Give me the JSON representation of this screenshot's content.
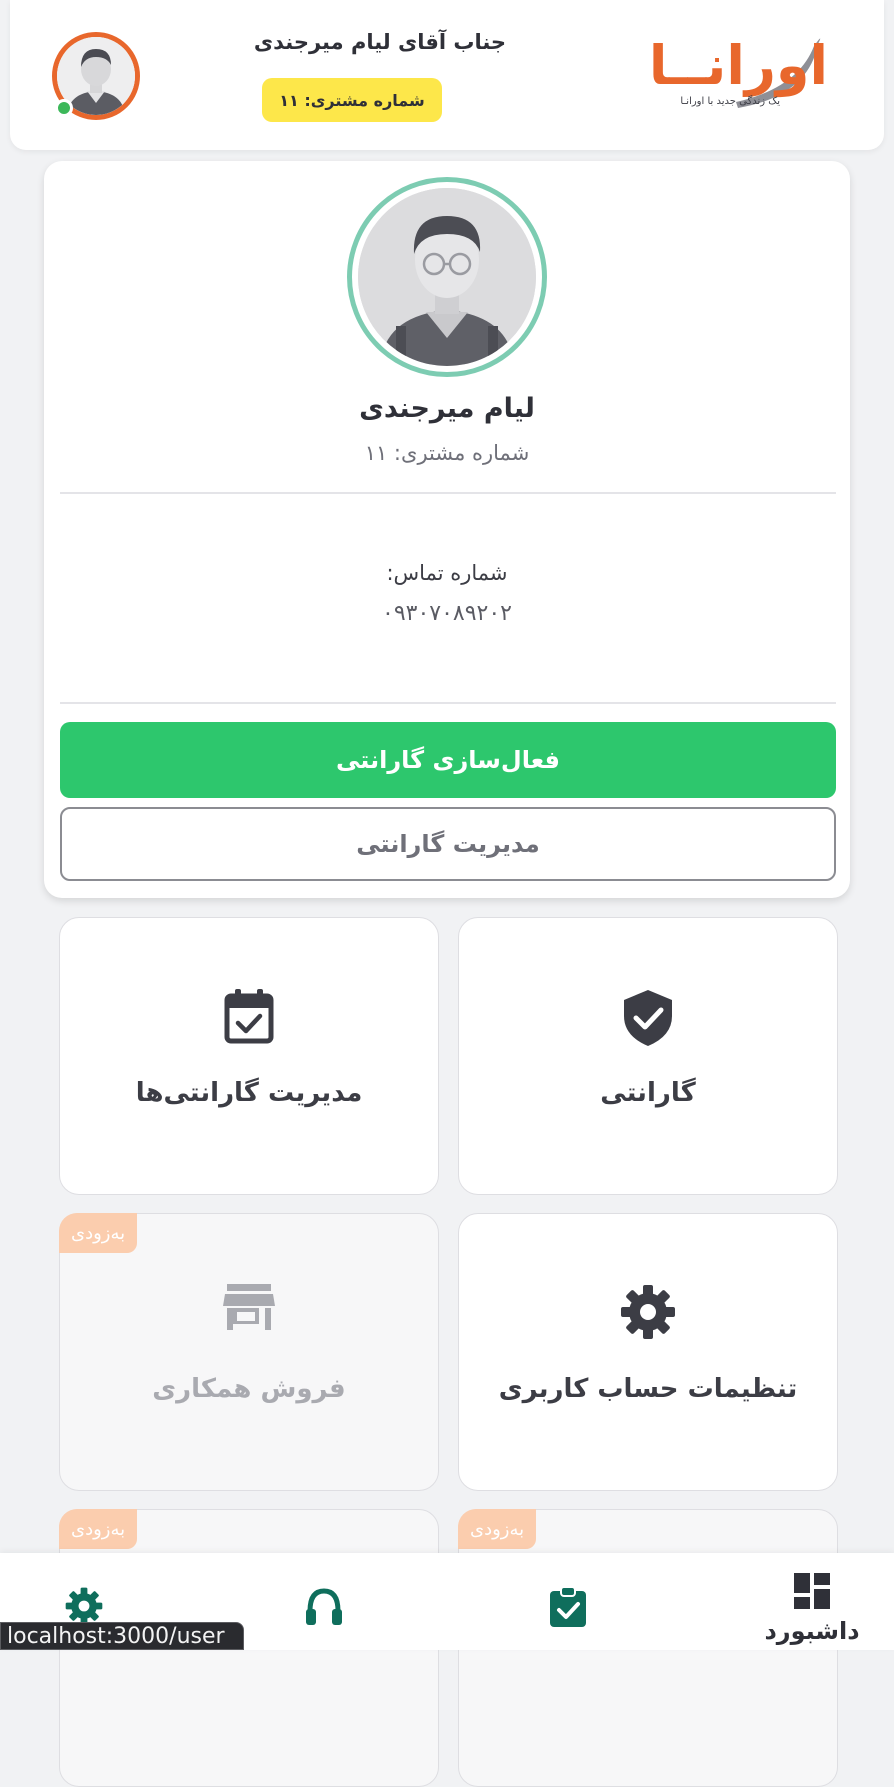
{
  "header": {
    "logo_text": "اورانــا",
    "logo_tagline": "یک زندگی جدید با اورانـا",
    "greeting": "جناب آقای لیام میرجندی",
    "customer_badge": "شماره مشتری: ۱۱",
    "online_status_color": "#3cb85a"
  },
  "profile": {
    "name": "لیام میرجندی",
    "customer_number": "شماره مشتری: ۱۱",
    "contact_label": "شماره تماس:",
    "contact_value": "۰۹۳۰۷۰۸۹۲۰۲",
    "activate_warranty_label": "فعال‌سازی گارانتی",
    "manage_warranty_label": "مدیریت گارانتی"
  },
  "tiles": [
    {
      "label": "گارانتی",
      "icon": "shield-check-icon",
      "coming_soon": false
    },
    {
      "label": "مدیریت گارانتی‌ها",
      "icon": "calendar-check-icon",
      "coming_soon": false
    },
    {
      "label": "تنظیمات حساب کاربری",
      "icon": "gear-icon",
      "coming_soon": false
    },
    {
      "label": "فروش همکاری",
      "icon": "store-icon",
      "coming_soon": true
    }
  ],
  "soon_label": "به‌زودی",
  "bottom_nav": [
    {
      "label": "داشبورد",
      "icon": "dashboard-icon",
      "active": true
    },
    {
      "label": "",
      "icon": "clipboard-check-icon",
      "active": false
    },
    {
      "label": "",
      "icon": "headset-icon",
      "active": false
    },
    {
      "label": "",
      "icon": "gear-icon",
      "active": false
    }
  ],
  "status_url": "localhost:3000/user",
  "colors": {
    "brand_orange": "#e8672c",
    "accent_green": "#2dc76d",
    "icon_teal": "#0f6e5c",
    "badge_yellow": "#fde74a",
    "soon_peach": "#fbcdae"
  }
}
